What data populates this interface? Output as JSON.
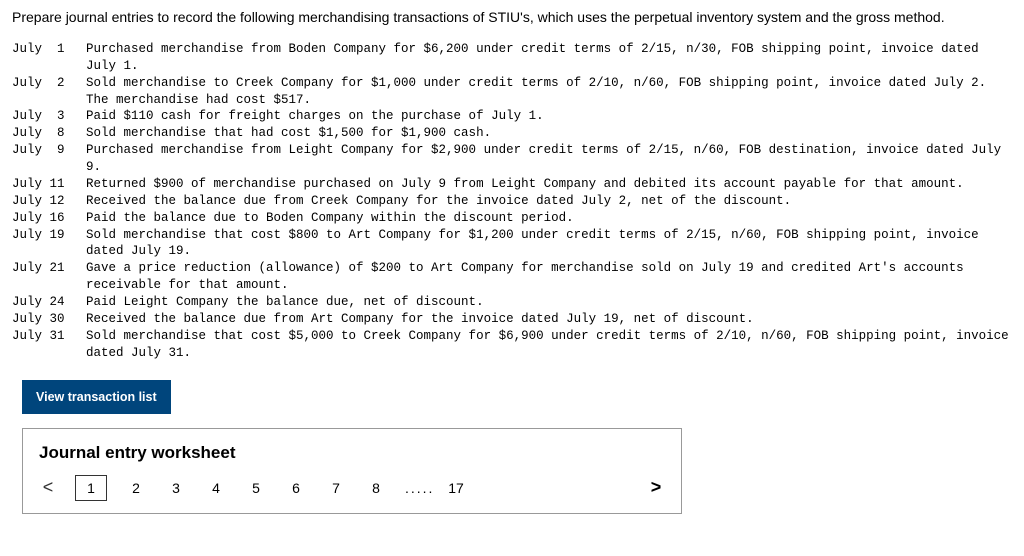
{
  "intro": "Prepare journal entries to record the following merchandising transactions of STIU's, which uses the perpetual inventory system and the gross method.",
  "transactions": [
    {
      "date": "July 1",
      "text": "Purchased merchandise from Boden Company for $6,200 under credit terms of 2/15, n/30, FOB shipping point, invoice dated July 1."
    },
    {
      "date": "July 2",
      "text": "Sold merchandise to Creek Company for $1,000 under credit terms of 2/10, n/60, FOB shipping point, invoice dated July 2. The merchandise had cost $517."
    },
    {
      "date": "July 3",
      "text": "Paid $110 cash for freight charges on the purchase of July 1."
    },
    {
      "date": "July 8",
      "text": "Sold merchandise that had cost $1,500 for $1,900 cash."
    },
    {
      "date": "July 9",
      "text": "Purchased merchandise from Leight Company for $2,900 under credit terms of 2/15, n/60, FOB destination, invoice dated July 9."
    },
    {
      "date": "July 11",
      "text": "Returned $900 of merchandise purchased on July 9 from Leight Company and debited its account payable for that amount."
    },
    {
      "date": "July 12",
      "text": "Received the balance due from Creek Company for the invoice dated July 2, net of the discount."
    },
    {
      "date": "July 16",
      "text": "Paid the balance due to Boden Company within the discount period."
    },
    {
      "date": "July 19",
      "text": "Sold merchandise that cost $800 to Art Company for $1,200 under credit terms of 2/15, n/60, FOB shipping point, invoice dated July 19."
    },
    {
      "date": "July 21",
      "text": "Gave a price reduction (allowance) of $200 to Art Company for merchandise sold on July 19 and credited Art's accounts receivable for that amount."
    },
    {
      "date": "July 24",
      "text": "Paid Leight Company the balance due, net of discount."
    },
    {
      "date": "July 30",
      "text": "Received the balance due from Art Company for the invoice dated July 19, net of discount."
    },
    {
      "date": "July 31",
      "text": "Sold merchandise that cost $5,000 to Creek Company for $6,900 under credit terms of 2/10, n/60, FOB shipping point, invoice dated July 31."
    }
  ],
  "view_btn_label": "View transaction list",
  "worksheet": {
    "title": "Journal entry worksheet",
    "pages": [
      "1",
      "2",
      "3",
      "4",
      "5",
      "6",
      "7",
      "8"
    ],
    "ellipsis": ".....",
    "last_page": "17",
    "chev_left": "<",
    "chev_right": ">"
  }
}
